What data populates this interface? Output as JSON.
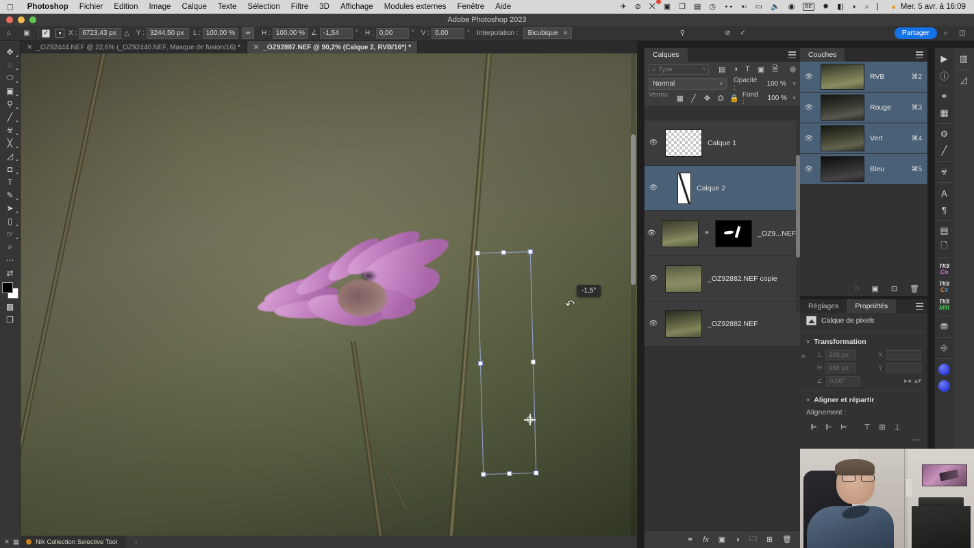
{
  "macmenu": {
    "apple_icon": "apple-icon",
    "items": [
      {
        "label": "Photoshop",
        "bold": true
      },
      {
        "label": "Fichier",
        "bold": false
      },
      {
        "label": "Edition",
        "bold": false
      },
      {
        "label": "Image",
        "bold": false
      },
      {
        "label": "Calque",
        "bold": false
      },
      {
        "label": "Texte",
        "bold": false
      },
      {
        "label": "Sélection",
        "bold": false
      },
      {
        "label": "Filtre",
        "bold": false
      },
      {
        "label": "3D",
        "bold": false
      },
      {
        "label": "Affichage",
        "bold": false
      },
      {
        "label": "Modules externes",
        "bold": false
      },
      {
        "label": "Fenêtre",
        "bold": false
      },
      {
        "label": "Aide",
        "bold": false
      }
    ],
    "status_icons": [
      {
        "name": "wifi-sharing-icon",
        "glyph": "✈"
      },
      {
        "name": "do-not-disturb-icon",
        "glyph": "⊘"
      },
      {
        "name": "notifications-icon",
        "glyph": "⠿"
      },
      {
        "name": "screen-record-icon",
        "glyph": "▣"
      },
      {
        "name": "clipboard-sync-icon",
        "glyph": "❐"
      },
      {
        "name": "notes-icon",
        "glyph": "▤"
      },
      {
        "name": "time-machine-icon",
        "glyph": "◷"
      },
      {
        "name": "search-binoculars-icon",
        "glyph": "⌖"
      },
      {
        "name": "stats-icon",
        "glyph": "▮▯"
      },
      {
        "name": "display-icon",
        "glyph": "▭"
      },
      {
        "name": "volume-icon",
        "glyph": "◀))"
      },
      {
        "name": "airplay-icon",
        "glyph": "◉"
      },
      {
        "name": "keyboard-layout-icon",
        "glyph": "BE"
      },
      {
        "name": "bluetooth-icon",
        "glyph": "✲"
      },
      {
        "name": "battery-icon",
        "glyph": "▰)"
      },
      {
        "name": "wifi-icon",
        "glyph": "◗"
      },
      {
        "name": "spotlight-icon",
        "glyph": "⌕"
      },
      {
        "name": "control-center-icon",
        "glyph": "⌸"
      }
    ],
    "clock": "Mer. 5 avr. à 16:09"
  },
  "titlebar": {
    "title": "Adobe Photoshop 2023"
  },
  "options_bar": {
    "home_icon": "home-icon",
    "transform_ref_icon": "transform-reference-icon",
    "show_transform_controls_checked": true,
    "ref_point_label": "reference-point-grid",
    "x_label": "X :",
    "x_value": "6723,43 px",
    "delta_icon_1": "delta-icon",
    "y_label": "Y :",
    "y_value": "3244,50 px",
    "w_label": "L :",
    "w_value": "100,00 %",
    "link_icon": "chain-link-icon",
    "h_label": "H :",
    "h_value": "100,00 %",
    "angle_icon": "angle-icon",
    "angle_value": "-1,54",
    "degree_symbol": "°",
    "skew_h_label": "H :",
    "skew_h_value": "0,00",
    "skew_v_label": "V :",
    "skew_v_value": "0,00",
    "interpolation_label": "Interpolation :",
    "interpolation_value": "Bicubique",
    "warp_icon": "warp-toggle-icon",
    "cancel_icon": "cancel-transform-icon",
    "commit_icon": "commit-transform-icon",
    "share_label": "Partager",
    "search_icon": "search-icon",
    "workspace_icon": "workspace-switcher-icon"
  },
  "doc_tabs": [
    {
      "title": "_OZ92444.NEF @ 22,6% (_OZ92440.NEF, Masque de fusion/16) *",
      "active": false
    },
    {
      "title": "_OZ92887.NEF @ 90,2% (Calque 2, RVB/16*) *",
      "active": true
    }
  ],
  "left_toolbar": [
    {
      "name": "move-tool",
      "glyph": "✥",
      "selected": false
    },
    {
      "name": "marquee-tool",
      "glyph": "◌",
      "selected": false
    },
    {
      "name": "lasso-tool",
      "glyph": "⬭",
      "selected": false
    },
    {
      "name": "object-selection-tool",
      "glyph": "⬚",
      "selected": false
    },
    {
      "name": "crop-tool",
      "glyph": "⌗",
      "selected": false
    },
    {
      "name": "eyedropper-tool",
      "glyph": "⚲",
      "selected": false
    },
    {
      "name": "spot-healing-tool",
      "glyph": "✎",
      "selected": false
    },
    {
      "name": "brush-tool",
      "glyph": "🖌",
      "selected": false
    },
    {
      "name": "clone-stamp-tool",
      "glyph": "⎙",
      "selected": false
    },
    {
      "name": "history-brush-tool",
      "glyph": "⧖",
      "selected": false
    },
    {
      "name": "eraser-tool",
      "glyph": "◫",
      "selected": false
    },
    {
      "name": "gradient-tool",
      "glyph": "▨",
      "selected": false
    },
    {
      "name": "blur-tool",
      "glyph": "◐",
      "selected": false
    },
    {
      "name": "dodge-tool",
      "glyph": "✋",
      "selected": false
    },
    {
      "name": "type-tool",
      "glyph": "T",
      "selected": false
    },
    {
      "name": "pen-tool",
      "glyph": "✒",
      "selected": false
    },
    {
      "name": "path-selection-tool",
      "glyph": "➤",
      "selected": false
    },
    {
      "name": "rectangle-tool",
      "glyph": "▭",
      "selected": false
    },
    {
      "name": "hand-tool",
      "glyph": "✊",
      "selected": false
    },
    {
      "name": "zoom-tool",
      "glyph": "🔍",
      "selected": false
    },
    {
      "name": "more-tools",
      "glyph": "•••",
      "selected": false
    },
    {
      "name": "swap-colors-icon",
      "glyph": "⇄",
      "selected": false
    },
    {
      "name": "quick-mask-toggle",
      "glyph": "◙",
      "selected": false
    },
    {
      "name": "screen-mode-toggle",
      "glyph": "❐",
      "selected": false
    }
  ],
  "canvas": {
    "rotation_tooltip": "-1,5°",
    "rotate-cursor": "rotate-cursor-icon",
    "transform_box": "free-transform-bounding-box",
    "pivot": "transform-pivot-point"
  },
  "statusbar": {
    "close_icon": "close-icon",
    "restore_icon": "restore-icon",
    "plugin_name": "Nik Collection Selective Tool",
    "plugin_dot_color": "#c8831e",
    "expand_arrow": "›"
  },
  "layers_panel": {
    "tab_label": "Calques",
    "panel_menu_icon": "panel-menu-icon",
    "search_placeholder": "Type",
    "search_icon": "search-icon",
    "filter_icons": [
      {
        "name": "filter-pixel-icon",
        "glyph": "▤"
      },
      {
        "name": "filter-adjustment-icon",
        "glyph": "◑"
      },
      {
        "name": "filter-type-icon",
        "glyph": "T"
      },
      {
        "name": "filter-shape-icon",
        "glyph": "▣"
      },
      {
        "name": "filter-smart-object-icon",
        "glyph": "🗎"
      }
    ],
    "filter_toggle": "filter-enable-toggle",
    "blend_mode": "Normal",
    "opacity_label": "Opacité :",
    "opacity_value": "100 %",
    "lock_label": "Verrou :",
    "lock_icons": [
      {
        "name": "lock-transparency-icon",
        "glyph": "▦"
      },
      {
        "name": "lock-image-icon",
        "glyph": "🖌"
      },
      {
        "name": "lock-position-icon",
        "glyph": "✥"
      },
      {
        "name": "lock-artboard-icon",
        "glyph": "⬓"
      },
      {
        "name": "lock-all-icon",
        "glyph": "🔒"
      }
    ],
    "fill_label": "Fond :",
    "fill_value": "100 %",
    "layers": [
      {
        "name": "Calque 1",
        "visible": true,
        "selected": false,
        "thumb": "checker",
        "mask": false
      },
      {
        "name": "Calque 2",
        "visible": true,
        "selected": true,
        "thumb": "maskstroke",
        "mask": false
      },
      {
        "name": "_OZ9...NEF",
        "visible": true,
        "selected": false,
        "thumb": "photo1",
        "mask": true
      },
      {
        "name": "_OZ92882.NEF copie",
        "visible": true,
        "selected": false,
        "thumb": "photo2",
        "mask": false
      },
      {
        "name": "_OZ92882.NEF",
        "visible": true,
        "selected": false,
        "thumb": "photo3",
        "mask": false
      }
    ],
    "footer_icons": [
      {
        "name": "link-layers-icon",
        "glyph": "⚭"
      },
      {
        "name": "layer-style-icon",
        "glyph": "fx"
      },
      {
        "name": "add-layer-mask-icon",
        "glyph": "▣"
      },
      {
        "name": "new-adjustment-layer-icon",
        "glyph": "◑"
      },
      {
        "name": "new-group-icon",
        "glyph": "🗀"
      },
      {
        "name": "new-layer-icon",
        "glyph": "⊞"
      },
      {
        "name": "delete-layer-icon",
        "glyph": "🗑"
      }
    ]
  },
  "channels_panel": {
    "tab_label": "Couches",
    "panel_menu_icon": "panel-menu-icon",
    "channels": [
      {
        "name": "RVB",
        "shortcut": "⌘2",
        "visible": true,
        "selected": true,
        "thumb": "rvb"
      },
      {
        "name": "Rouge",
        "shortcut": "⌘3",
        "visible": true,
        "selected": true,
        "thumb": "r"
      },
      {
        "name": "Vert",
        "shortcut": "⌘4",
        "visible": true,
        "selected": true,
        "thumb": "v"
      },
      {
        "name": "Bleu",
        "shortcut": "⌘5",
        "visible": true,
        "selected": true,
        "thumb": "b"
      }
    ],
    "footer_icons": [
      {
        "name": "load-channel-as-selection-icon",
        "glyph": "⬚"
      },
      {
        "name": "save-selection-as-channel-icon",
        "glyph": "▣"
      },
      {
        "name": "new-channel-icon",
        "glyph": "⊡"
      },
      {
        "name": "delete-channel-icon",
        "glyph": "🗑"
      }
    ]
  },
  "properties_panel": {
    "tabs": [
      {
        "label": "Réglages",
        "active": false
      },
      {
        "label": "Propriétés",
        "active": true
      }
    ],
    "panel_menu_icon": "panel-menu-icon",
    "layer_kind_icon": "pixel-layer-icon",
    "layer_kind_label": "Calque de pixels",
    "transform_section": "Transformation",
    "chain_icon": "constrain-proportions-icon",
    "w_label": "L",
    "w_value": "233 px",
    "h_label": "H",
    "h_value": "988 px",
    "x_label": "X",
    "x_value": "",
    "y_label": "Y",
    "y_value": "",
    "angle_icon": "rotation-angle-icon",
    "angle_value": "0,00°",
    "flip_horizontal_icon": "flip-horizontal-icon",
    "flip_vertical_icon": "flip-vertical-icon",
    "align_section": "Aligner et répartir",
    "align_label": "Alignement :",
    "align_icons": [
      {
        "name": "align-left-icon",
        "glyph": "⊫"
      },
      {
        "name": "align-center-horizontal-icon",
        "glyph": "⊹"
      },
      {
        "name": "align-right-icon",
        "glyph": "⊨"
      },
      {
        "name": "align-top-icon",
        "glyph": "⊤"
      },
      {
        "name": "align-middle-vertical-icon",
        "glyph": "⊹"
      },
      {
        "name": "align-bottom-icon",
        "glyph": "⊥"
      }
    ],
    "more_options_icon": "more-options-icon"
  },
  "right_rail": [
    {
      "name": "play-actions-icon",
      "glyph": "▶"
    },
    {
      "name": "info-icon",
      "glyph": "ⓘ"
    },
    {
      "name": "color-panel-icon",
      "glyph": "◍"
    },
    {
      "name": "swatches-panel-icon",
      "glyph": "▦"
    },
    {
      "name": "adjustments-panel-icon",
      "glyph": "⚙"
    },
    {
      "name": "brush-settings-icon",
      "glyph": "🖌"
    },
    {
      "name": "clone-source-icon",
      "glyph": "⎙"
    },
    {
      "name": "character-panel-icon",
      "glyph": "A"
    },
    {
      "name": "paragraph-panel-icon",
      "glyph": "¶"
    },
    {
      "name": "libraries-panel-icon",
      "glyph": "▤"
    },
    {
      "name": "notes-panel-icon",
      "glyph": "🗒"
    },
    {
      "name": "tk8-co-icon",
      "glyph": "TK8 Co"
    },
    {
      "name": "tk8-cx-icon",
      "glyph": "TK8 Cx"
    },
    {
      "name": "tk8-mm-icon",
      "glyph": "TK8 MM"
    },
    {
      "name": "luminosity-mask-icon",
      "glyph": "⛃"
    },
    {
      "name": "actions-panel-icon",
      "glyph": "⎆"
    },
    {
      "name": "plugin-blue-icon",
      "glyph": "●"
    },
    {
      "name": "plugin-blue2-icon",
      "glyph": "●"
    }
  ],
  "right_rail_2": [
    {
      "name": "histogram-panel-icon",
      "glyph": "▥"
    },
    {
      "name": "paths-panel-icon",
      "glyph": "⌇"
    }
  ],
  "webcam": {
    "label": "webcam-overlay"
  },
  "colors": {
    "accent_blue": "#1473e6",
    "selected_layer": "#4a6077",
    "panel_bg": "#323232",
    "toolbar_bg": "#353535",
    "transform_outline": "#9aa6d8"
  }
}
